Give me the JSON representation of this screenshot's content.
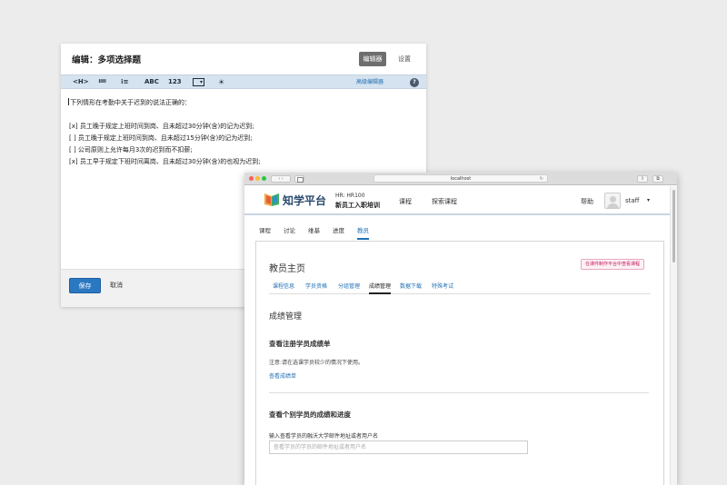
{
  "editor": {
    "title": "编辑：多项选择题",
    "tab_editor": "编辑器",
    "tab_settings": "设置",
    "toolbar": {
      "heading": "<H>",
      "bullet_list": "≔",
      "numbered_list": "⁝≡",
      "text": "ABC",
      "number": "123",
      "dropdown": "▾",
      "hint": "☀",
      "advanced": "高级编辑器",
      "help": "?"
    },
    "question": "下列情形在考勤中关于迟到的说法正确的：",
    "options": [
      "[x]  员工晚于规定上班时间到岗、且未超过30分钟(含)的记为迟到;",
      "[ ]  员工晚于规定上班时间到岗、且未超过15分钟(含)的记为迟到;",
      "[ ]  公司原则上允许每月3次的迟到而不扣薪;",
      "[x]  员工早于规定下班时间离岗、且未超过30分钟(含)的也视为迟到;"
    ],
    "save": "保存",
    "cancel": "取消"
  },
  "browser": {
    "url": "localhost",
    "nav": "‹  ›",
    "reload": "↻",
    "share": "⇪",
    "tabs": "⧉"
  },
  "site": {
    "logo_text": "知学平台",
    "course_org": "HR: HR100",
    "course_name": "新员工入职培训",
    "nav_course": "课程",
    "nav_explore": "探索课程",
    "help": "帮助",
    "username": "staff",
    "caret": "▾"
  },
  "course_tabs": [
    "课程",
    "讨论",
    "维基",
    "进度",
    "教员"
  ],
  "instructor": {
    "title": "教员主页",
    "studio_badge": "在课件制作平台中查看课程",
    "tabs": [
      "课程信息",
      "学员资格",
      "分组管理",
      "成绩管理",
      "数据下载",
      "特殊考试"
    ],
    "section_title": "成绩管理",
    "gradebook_title": "查看注册学员成绩单",
    "gradebook_note": "注意:请在选课学员较少的情况下使用。",
    "gradebook_link": "查看成绩单",
    "individual_title": "查看个别学员的成绩和进度",
    "input_label": "输入查看学员的融沃大学邮件地址或者用户名",
    "input_placeholder": "查看学员的学员的邮件地址或者用户名"
  },
  "colors": {
    "primary": "#2b78c2",
    "link": "#1f6fb5",
    "toolbar_bg": "#d5e2ef",
    "badge": "#c2185b"
  }
}
